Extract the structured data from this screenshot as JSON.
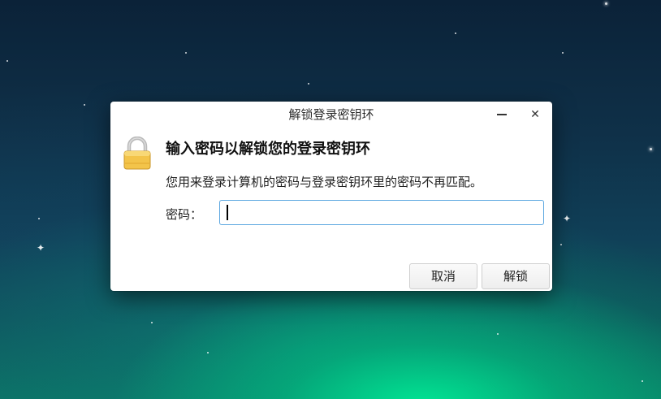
{
  "dialog": {
    "title": "解锁登录密钥环",
    "heading": "输入密码以解锁您的登录密钥环",
    "message": "您用来登录计算机的密码与登录密钥环里的密码不再匹配。",
    "password_label": "密码：",
    "password_value": "",
    "minimize_icon": "minimize-icon",
    "close_icon": "close-icon",
    "close_glyph": "✕",
    "lock_icon": "padlock-icon",
    "buttons": {
      "cancel": "取消",
      "unlock": "解锁"
    }
  },
  "colors": {
    "input_focus_border": "#5aa6e0",
    "lock_body": "#f3c44a",
    "lock_shackle": "#b9b9b9"
  }
}
